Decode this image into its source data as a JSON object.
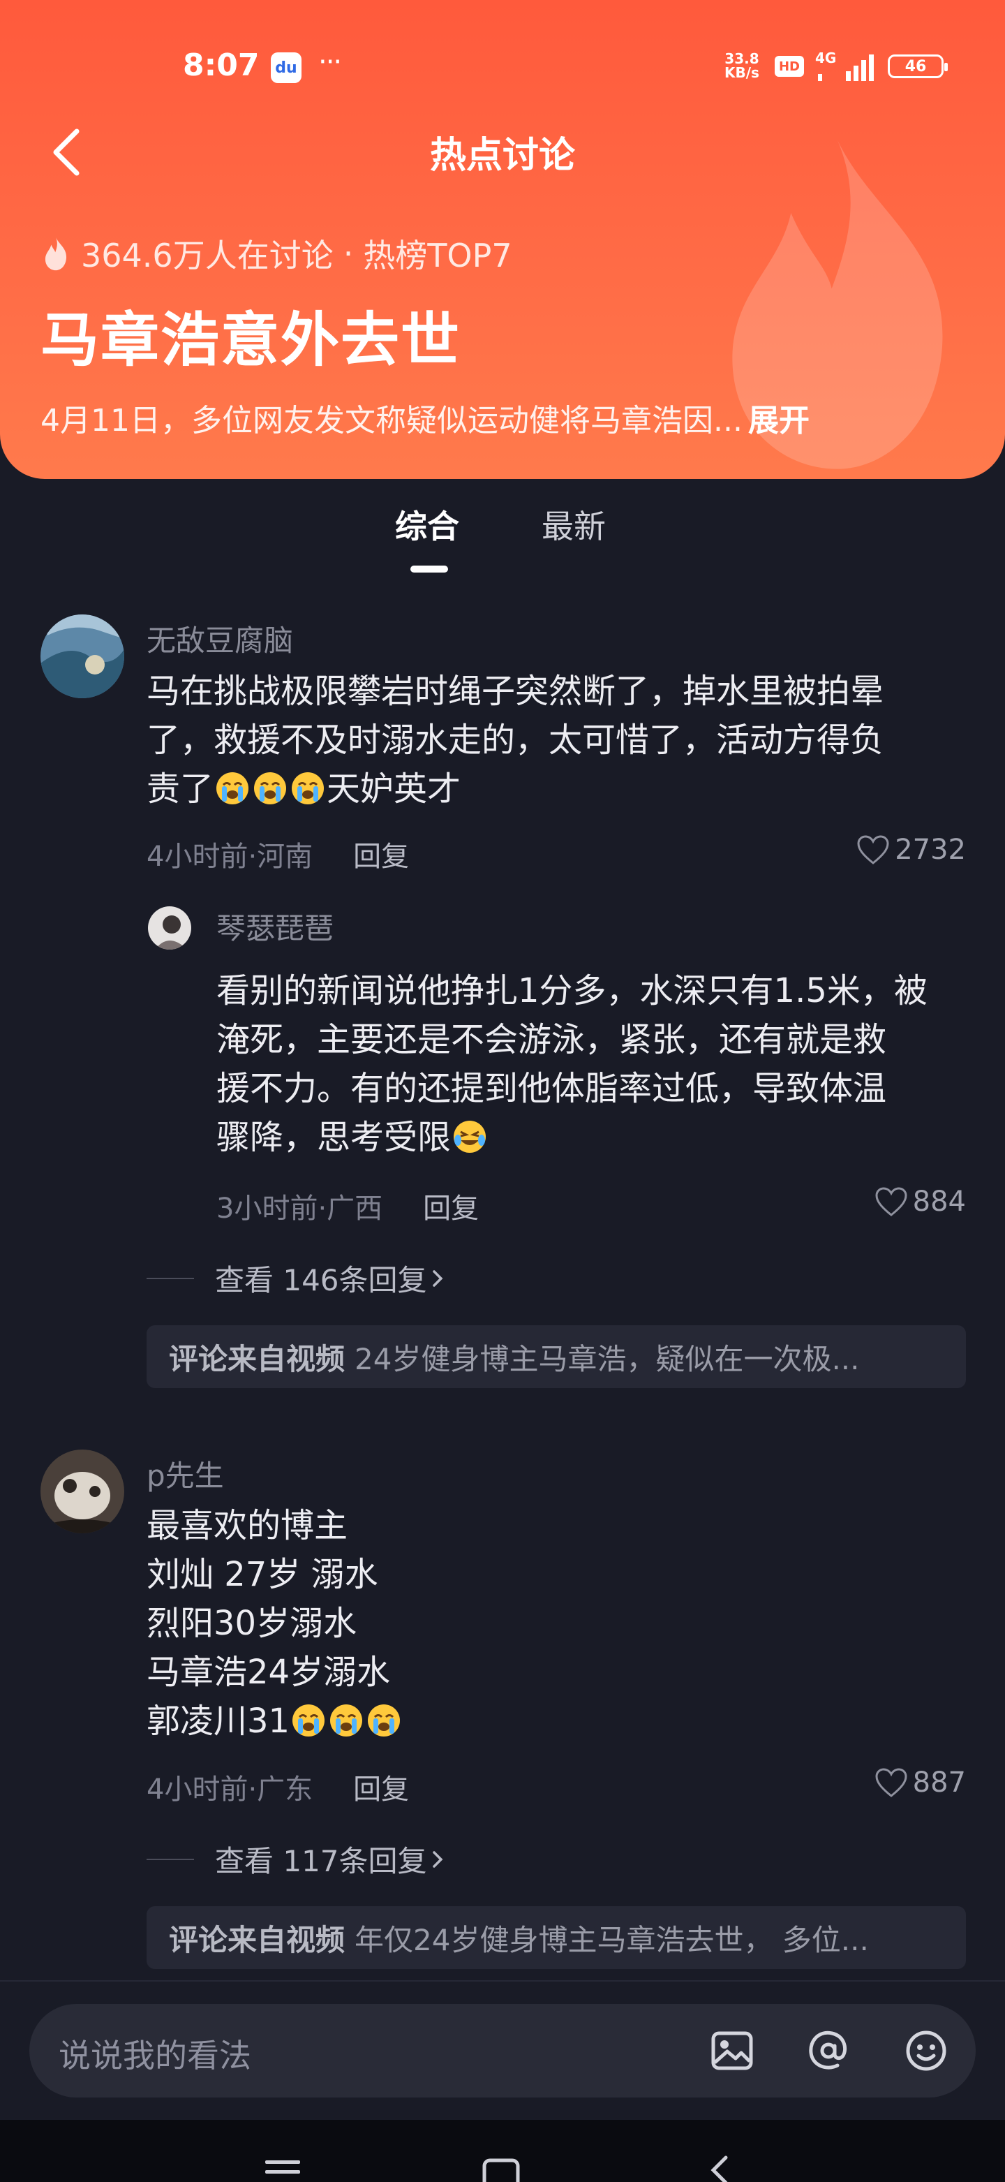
{
  "status_bar": {
    "time": "8:07",
    "app_icon_label": "du",
    "more": "···",
    "net_speed_value": "33.8",
    "net_speed_unit": "KB/s",
    "hd": "HD",
    "network": "4G",
    "battery": "46"
  },
  "header": {
    "title": "热点讨论",
    "participants": "364.6万人在讨论",
    "separator": "·",
    "rank": "热榜TOP7",
    "headline": "马章浩意外去世",
    "summary": "4月11日，多位网友发文称疑似运动健将马章浩因...",
    "expand": "展开"
  },
  "tabs": [
    {
      "label": "综合",
      "active": true
    },
    {
      "label": "最新",
      "active": false
    }
  ],
  "comments": [
    {
      "user": "无敌豆腐脑",
      "text_line1": "马在挑战极限攀岩时绳子突然断了，掉水里被拍晕",
      "text_line2": "了，救援不及时溺水走的，太可惜了，活动方得负",
      "text_line3_pre": "责了",
      "text_line3_post": "天妒英才",
      "time_location": "4小时前·河南",
      "reply": "回复",
      "likes": "2732",
      "sub_reply": {
        "user": "琴瑟琵琶",
        "line1": "看别的新闻说他挣扎1分多，水深只有1.5米，被",
        "line2": "淹死，主要还是不会游泳，紧张，还有就是救",
        "line3": "援不力。有的还提到他体脂率过低，导致体温",
        "line4": "骤降，思考受限",
        "time_location": "3小时前·广西",
        "reply": "回复",
        "likes": "884"
      },
      "view_replies": "查看 146条回复",
      "source_label": "评论来自视频",
      "source_text": "24岁健身博主马章浩，疑似在一次极..."
    },
    {
      "user": "p先生",
      "line1": "最喜欢的博主",
      "line2": "刘灿 27岁 溺水",
      "line3": "烈阳30岁溺水",
      "line4": "马章浩24岁溺水",
      "line5": "郭凌川31",
      "time_location": "4小时前·广东",
      "reply": "回复",
      "likes": "887",
      "view_replies": "查看 117条回复",
      "source_label": "评论来自视频",
      "source_text": "年仅24岁健身博主马章浩去世， 多位..."
    }
  ],
  "input": {
    "placeholder": "说说我的看法"
  },
  "icons": [
    "back-icon",
    "flame-icon",
    "heart-icon",
    "chevron-right-icon",
    "image-icon",
    "at-icon",
    "emoji-icon",
    "crying-emoji",
    "laughing-crying-emoji"
  ],
  "colors": {
    "header_start": "#ff5a3c",
    "header_end": "#ff7a4c",
    "background": "#191b26"
  }
}
